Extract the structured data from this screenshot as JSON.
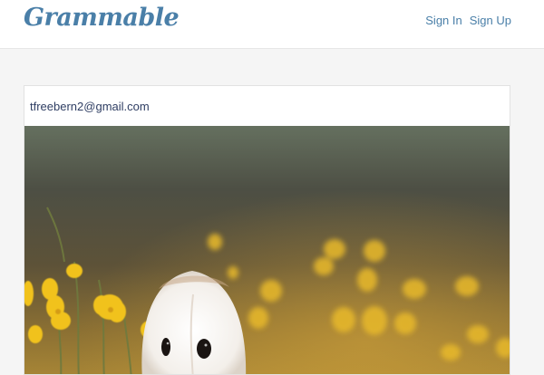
{
  "navbar": {
    "brand": "Grammable",
    "links": [
      {
        "label": "Sign In"
      },
      {
        "label": "Sign Up"
      }
    ]
  },
  "post": {
    "author_email": "tfreebern2@gmail.com",
    "image": {
      "subject": "barn owl in a field of yellow flowers"
    }
  },
  "colors": {
    "brand": "#4a7fa8",
    "email_text": "#2f3e63",
    "page_background": "#f5f5f5"
  }
}
